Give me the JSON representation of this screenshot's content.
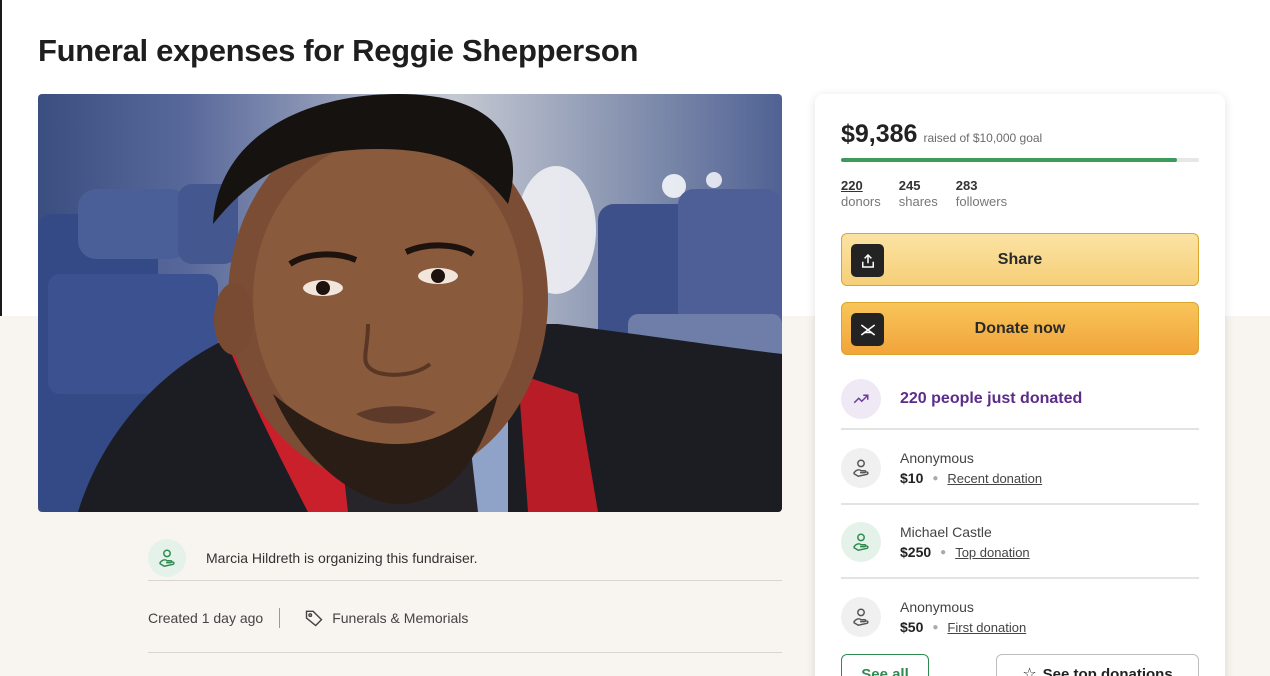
{
  "page": {
    "title": "Funeral expenses for Reggie Shepperson"
  },
  "organizer": {
    "text": "Marcia Hildreth is organizing this fundraiser."
  },
  "meta": {
    "created": "Created 1 day ago",
    "category": "Funerals & Memorials"
  },
  "campaign": {
    "raised": "$9,386",
    "goal_text": "raised of $10,000 goal",
    "progress_fraction": 0.9386,
    "stats": [
      {
        "value": "220",
        "label": "donors"
      },
      {
        "value": "245",
        "label": "shares"
      },
      {
        "value": "283",
        "label": "followers"
      }
    ],
    "share_label": "Share",
    "donate_label": "Donate now",
    "trend_text": "220 people just donated",
    "donations": [
      {
        "name": "Anonymous",
        "amount": "$10",
        "tag": "Recent donation"
      },
      {
        "name": "Michael Castle",
        "amount": "$250",
        "tag": "Top donation"
      },
      {
        "name": "Anonymous",
        "amount": "$50",
        "tag": "First donation"
      }
    ],
    "see_all_label": "See all",
    "see_top_label": "See top donations"
  },
  "icons": {
    "share": "upload-icon",
    "donate": "gofundme-icon",
    "trend": "trending-up-icon",
    "donor": "hand-heart-icon",
    "tag": "tag-icon",
    "star": "star-icon"
  },
  "colors": {
    "progress": "#3d9a5a",
    "trend_text": "#5b2c8a",
    "share_button": "#f6cf78",
    "donate_button": "#f1a43a",
    "see_all": "#2f8a4f"
  }
}
